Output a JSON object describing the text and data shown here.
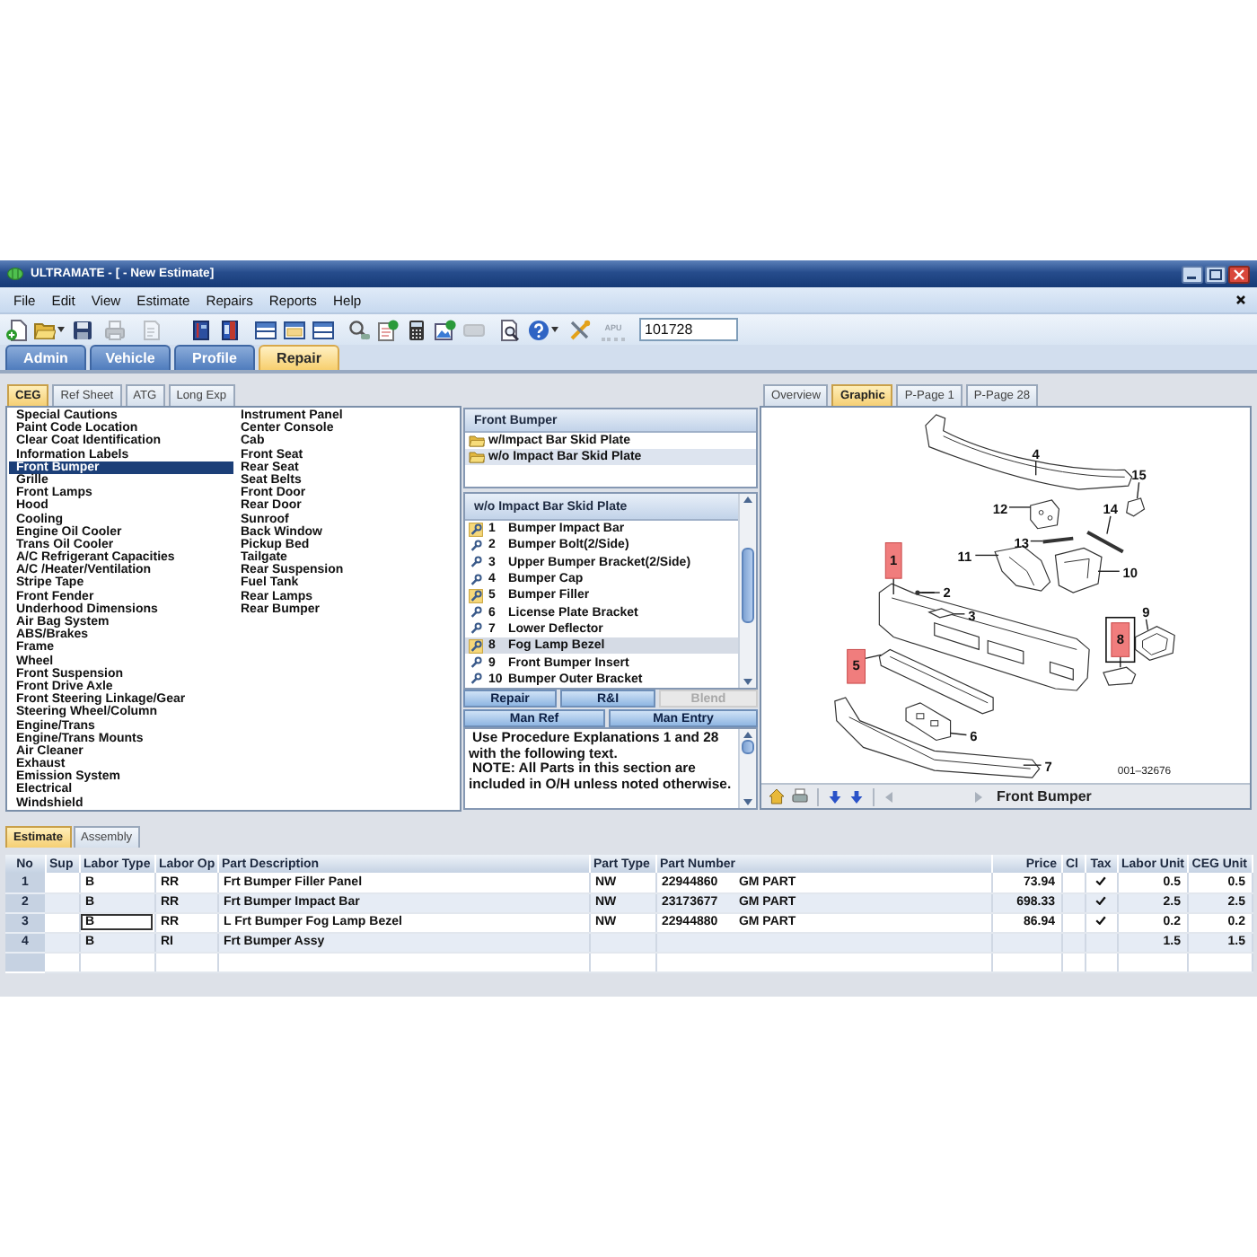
{
  "window": {
    "title": "ULTRAMATE - [ - New Estimate]"
  },
  "menu": [
    "File",
    "Edit",
    "View",
    "Estimate",
    "Repairs",
    "Reports",
    "Help"
  ],
  "toolbar": {
    "buttons": [
      {
        "kind": "new",
        "disabled": false
      },
      {
        "kind": "open",
        "disabled": false
      },
      {
        "kind": "save",
        "disabled": false
      },
      {
        "kind": "print",
        "disabled": true
      },
      {
        "kind": "preview",
        "disabled": true
      },
      {
        "kind": "book",
        "disabled": false
      },
      {
        "kind": "manual",
        "disabled": false
      },
      {
        "kind": "layout-top",
        "disabled": false
      },
      {
        "kind": "layout-split",
        "disabled": false
      },
      {
        "kind": "layout-bottom",
        "disabled": false
      },
      {
        "kind": "search",
        "disabled": false
      },
      {
        "kind": "invoice",
        "disabled": false
      },
      {
        "kind": "calculator",
        "disabled": false
      },
      {
        "kind": "photo",
        "disabled": false
      },
      {
        "kind": "card",
        "disabled": true
      },
      {
        "kind": "find",
        "disabled": false
      },
      {
        "kind": "help",
        "disabled": false
      },
      {
        "kind": "tools",
        "disabled": false
      },
      {
        "kind": "apu",
        "label": "APU",
        "disabled": true
      }
    ],
    "field": {
      "value": "101728"
    }
  },
  "main_tabs": [
    {
      "label": "Admin",
      "selected": false
    },
    {
      "label": "Vehicle",
      "selected": false
    },
    {
      "label": "Profile",
      "selected": false
    },
    {
      "label": "Repair",
      "selected": true
    }
  ],
  "categories_panel": {
    "tabs": [
      {
        "label": "CEG",
        "selected": true
      },
      {
        "label": "Ref Sheet",
        "selected": false
      },
      {
        "label": "ATG",
        "selected": false
      },
      {
        "label": "Long Exp",
        "selected": false
      }
    ],
    "items": [
      {
        "label": "Special Cautions",
        "selected": false
      },
      {
        "label": "Paint Code Location",
        "selected": false
      },
      {
        "label": "Clear Coat Identification",
        "selected": false
      },
      {
        "label": "Information Labels",
        "selected": false
      },
      {
        "label": "Front Bumper",
        "selected": true
      },
      {
        "label": "Grille",
        "selected": false
      },
      {
        "label": "Front Lamps",
        "selected": false
      },
      {
        "label": "Hood",
        "selected": false
      },
      {
        "label": "Cooling",
        "selected": false
      },
      {
        "label": "Engine Oil Cooler",
        "selected": false
      },
      {
        "label": "Trans Oil Cooler",
        "selected": false
      },
      {
        "label": "A/C Refrigerant Capacities",
        "selected": false
      },
      {
        "label": "A/C /Heater/Ventilation",
        "selected": false
      },
      {
        "label": "Stripe Tape",
        "selected": false
      },
      {
        "label": "Front Fender",
        "selected": false
      },
      {
        "label": "Underhood Dimensions",
        "selected": false
      },
      {
        "label": "Air Bag System",
        "selected": false
      },
      {
        "label": "ABS/Brakes",
        "selected": false
      },
      {
        "label": "Frame",
        "selected": false
      },
      {
        "label": "Wheel",
        "selected": false
      },
      {
        "label": "Front Suspension",
        "selected": false
      },
      {
        "label": "Front Drive Axle",
        "selected": false
      },
      {
        "label": "Front Steering Linkage/Gear",
        "selected": false
      },
      {
        "label": "Steering Wheel/Column",
        "selected": false
      },
      {
        "label": "Engine/Trans",
        "selected": false
      },
      {
        "label": "Engine/Trans Mounts",
        "selected": false
      },
      {
        "label": "Air Cleaner",
        "selected": false
      },
      {
        "label": "Exhaust",
        "selected": false
      },
      {
        "label": "Emission System",
        "selected": false
      },
      {
        "label": "Electrical",
        "selected": false
      },
      {
        "label": "Windshield",
        "selected": false
      },
      {
        "label": "Instrument Panel",
        "selected": false
      },
      {
        "label": "Center Console",
        "selected": false
      },
      {
        "label": "Cab",
        "selected": false
      },
      {
        "label": "Front Seat",
        "selected": false
      },
      {
        "label": "Rear Seat",
        "selected": false
      },
      {
        "label": "Seat Belts",
        "selected": false
      },
      {
        "label": "Front Door",
        "selected": false
      },
      {
        "label": "Rear Door",
        "selected": false
      },
      {
        "label": "Sunroof",
        "selected": false
      },
      {
        "label": "Back Window",
        "selected": false
      },
      {
        "label": "Pickup Bed",
        "selected": false
      },
      {
        "label": "Tailgate",
        "selected": false
      },
      {
        "label": "Rear Suspension",
        "selected": false
      },
      {
        "label": "Fuel Tank",
        "selected": false
      },
      {
        "label": "Rear Lamps",
        "selected": false
      },
      {
        "label": "Rear Bumper",
        "selected": false
      }
    ]
  },
  "procedure_panel": {
    "variants": {
      "title": "Front Bumper",
      "items": [
        {
          "label": "w/Impact Bar Skid Plate",
          "selected": false
        },
        {
          "label": "w/o Impact Bar Skid Plate",
          "selected": true
        }
      ]
    },
    "parts": {
      "title": "w/o Impact Bar Skid Plate",
      "items": [
        {
          "number": "1",
          "name": "Bumper Impact Bar",
          "in_estimate": true,
          "selected": false
        },
        {
          "number": "2",
          "name": "Bumper Bolt(2/Side)",
          "in_estimate": false,
          "selected": false
        },
        {
          "number": "3",
          "name": "Upper Bumper Bracket(2/Side)",
          "in_estimate": false,
          "selected": false
        },
        {
          "number": "4",
          "name": "Bumper Cap",
          "in_estimate": false,
          "selected": false
        },
        {
          "number": "5",
          "name": "Bumper Filler",
          "in_estimate": true,
          "selected": false
        },
        {
          "number": "6",
          "name": "License Plate Bracket",
          "in_estimate": false,
          "selected": false
        },
        {
          "number": "7",
          "name": "Lower Deflector",
          "in_estimate": false,
          "selected": false
        },
        {
          "number": "8",
          "name": "Fog Lamp Bezel",
          "in_estimate": true,
          "selected": true
        },
        {
          "number": "9",
          "name": "Front Bumper Insert",
          "in_estimate": false,
          "selected": false
        },
        {
          "number": "10",
          "name": "Bumper Outer Bracket",
          "in_estimate": false,
          "selected": false
        }
      ]
    },
    "actions": [
      {
        "label": "Repair",
        "disabled": false
      },
      {
        "label": "R&I",
        "disabled": false
      },
      {
        "label": "Blend",
        "disabled": true
      }
    ],
    "entry_buttons": [
      "Man Ref",
      "Man Entry"
    ],
    "notes": [
      "Use Procedure Explanations 1 and 28 with the following text.",
      "NOTE: All Parts in this section are included in O/H unless noted otherwise."
    ]
  },
  "graphic_panel": {
    "tabs": [
      {
        "label": "Overview",
        "selected": false
      },
      {
        "label": "Graphic",
        "selected": true
      },
      {
        "label": "P-Page 1",
        "selected": false
      },
      {
        "label": "P-Page 28",
        "selected": false
      }
    ],
    "callouts": [
      {
        "number": "1",
        "highlighted": true,
        "selected": false
      },
      {
        "number": "2",
        "highlighted": false,
        "selected": false
      },
      {
        "number": "3",
        "highlighted": false,
        "selected": false
      },
      {
        "number": "4",
        "highlighted": false,
        "selected": false
      },
      {
        "number": "5",
        "highlighted": true,
        "selected": false
      },
      {
        "number": "6",
        "highlighted": false,
        "selected": false
      },
      {
        "number": "7",
        "highlighted": false,
        "selected": false
      },
      {
        "number": "8",
        "highlighted": true,
        "selected": true
      },
      {
        "number": "9",
        "highlighted": false,
        "selected": false
      },
      {
        "number": "10",
        "highlighted": false,
        "selected": false
      },
      {
        "number": "11",
        "highlighted": false,
        "selected": false
      },
      {
        "number": "12",
        "highlighted": false,
        "selected": false
      },
      {
        "number": "13",
        "highlighted": false,
        "selected": false
      },
      {
        "number": "14",
        "highlighted": false,
        "selected": false
      },
      {
        "number": "15",
        "highlighted": false,
        "selected": false
      }
    ],
    "figure_id": "001–32676",
    "caption": "Front Bumper"
  },
  "estimate": {
    "tabs": [
      {
        "label": "Estimate",
        "selected": true
      },
      {
        "label": "Assembly",
        "selected": false
      }
    ],
    "columns": [
      "No",
      "Sup",
      "Labor Type",
      "Labor Op",
      "Part Description",
      "Part Type",
      "Part Number",
      "Price",
      "Cl",
      "Tax",
      "Labor Unit",
      "CEG Unit"
    ],
    "rows": [
      {
        "no": "1",
        "labor_type": "B",
        "labor_op": "RR",
        "description": "Frt Bumper Filler Panel",
        "part_type": "NW",
        "part_number": "22944860",
        "source": "GM PART",
        "price": "73.94",
        "tax": true,
        "labor_unit": "0.5",
        "ceg_unit": "0.5",
        "labor_type_focused": false
      },
      {
        "no": "2",
        "labor_type": "B",
        "labor_op": "RR",
        "description": "Frt Bumper Impact Bar",
        "part_type": "NW",
        "part_number": "23173677",
        "source": "GM PART",
        "price": "698.33",
        "tax": true,
        "labor_unit": "2.5",
        "ceg_unit": "2.5",
        "labor_type_focused": false
      },
      {
        "no": "3",
        "labor_type": "B",
        "labor_op": "RR",
        "description": "L Frt Bumper Fog Lamp Bezel",
        "part_type": "NW",
        "part_number": "22944880",
        "source": "GM PART",
        "price": "86.94",
        "tax": true,
        "labor_unit": "0.2",
        "ceg_unit": "0.2",
        "labor_type_focused": true
      },
      {
        "no": "4",
        "labor_type": "B",
        "labor_op": "RI",
        "description": "Frt Bumper Assy",
        "tax": false,
        "labor_unit": "1.5",
        "ceg_unit": "1.5",
        "labor_type_focused": false
      }
    ]
  }
}
